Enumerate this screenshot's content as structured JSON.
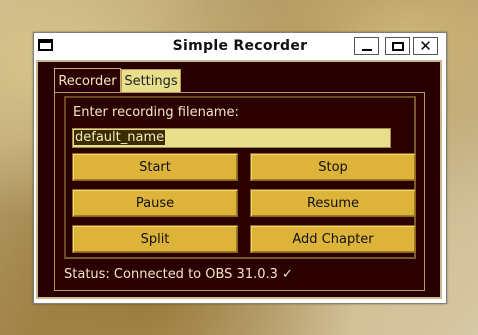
{
  "window": {
    "title": "Simple Recorder",
    "controls": {
      "minimize": "minimize",
      "maximize": "maximize",
      "close": "close"
    }
  },
  "tabs": [
    {
      "label": "Recorder",
      "selected": true
    },
    {
      "label": "Settings",
      "selected": false
    }
  ],
  "recorder": {
    "prompt": "Enter recording filename:",
    "filename_value": "default_name",
    "buttons": {
      "start": "Start",
      "stop": "Stop",
      "pause": "Pause",
      "resume": "Resume",
      "split": "Split",
      "add_chapter": "Add Chapter"
    },
    "status": "Status: Connected to OBS 31.0.3 ✓"
  },
  "colors": {
    "panel_bg": "#2b0000",
    "button_bg": "#ddb33a",
    "input_bg": "#e8de8c",
    "text_light": "#f3e7c4"
  },
  "icons": {
    "app": "window-icon",
    "minimize": "minimize-icon",
    "maximize": "maximize-icon",
    "close": "close-icon"
  }
}
